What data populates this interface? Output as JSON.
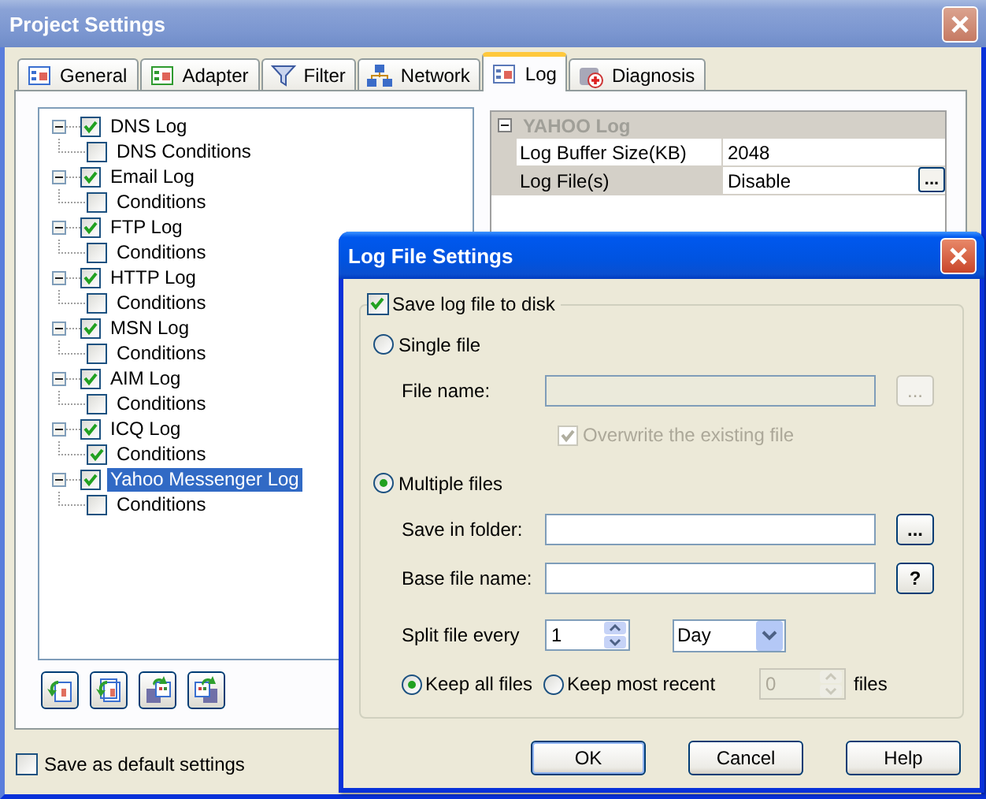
{
  "window": {
    "title": "Project Settings"
  },
  "tabs": [
    {
      "label": "General",
      "selected": false
    },
    {
      "label": "Adapter",
      "selected": false
    },
    {
      "label": "Filter",
      "selected": false
    },
    {
      "label": "Network",
      "selected": false
    },
    {
      "label": "Log",
      "selected": true
    },
    {
      "label": "Diagnosis",
      "selected": false
    }
  ],
  "tree": [
    {
      "label": "DNS Log",
      "checked": true,
      "selected": false,
      "expanded": true,
      "children": [
        {
          "label": "DNS Conditions",
          "checked": false,
          "selected": false
        }
      ]
    },
    {
      "label": "Email Log",
      "checked": true,
      "selected": false,
      "expanded": true,
      "children": [
        {
          "label": "Conditions",
          "checked": false,
          "selected": false
        }
      ]
    },
    {
      "label": "FTP Log",
      "checked": true,
      "selected": false,
      "expanded": true,
      "children": [
        {
          "label": "Conditions",
          "checked": false,
          "selected": false
        }
      ]
    },
    {
      "label": "HTTP Log",
      "checked": true,
      "selected": false,
      "expanded": true,
      "children": [
        {
          "label": "Conditions",
          "checked": false,
          "selected": false
        }
      ]
    },
    {
      "label": "MSN Log",
      "checked": true,
      "selected": false,
      "expanded": true,
      "children": [
        {
          "label": "Conditions",
          "checked": false,
          "selected": false
        }
      ]
    },
    {
      "label": "AIM Log",
      "checked": true,
      "selected": false,
      "expanded": true,
      "children": [
        {
          "label": "Conditions",
          "checked": false,
          "selected": false
        }
      ]
    },
    {
      "label": "ICQ Log",
      "checked": true,
      "selected": false,
      "expanded": true,
      "children": [
        {
          "label": "Conditions",
          "checked": true,
          "selected": false
        }
      ]
    },
    {
      "label": "Yahoo Messenger Log",
      "checked": true,
      "selected": true,
      "expanded": true,
      "children": [
        {
          "label": "Conditions",
          "checked": false,
          "selected": false
        }
      ]
    }
  ],
  "property_grid": {
    "category": "YAHOO Log",
    "expanded": true,
    "rows": [
      {
        "name": "Log Buffer Size(KB)",
        "value": "2048",
        "selected": false
      },
      {
        "name": "Log File(s)",
        "value": "Disable",
        "selected": true,
        "button": "..."
      }
    ]
  },
  "default_settings": {
    "label": "Save as default settings",
    "checked": false
  },
  "dialog": {
    "title": "Log File Settings",
    "save_to_disk": {
      "label": "Save log file to disk",
      "checked": true
    },
    "single_file": {
      "label": "Single file",
      "selected": false
    },
    "file_name": {
      "label": "File name:",
      "disabled": true,
      "button": "..."
    },
    "overwrite": {
      "label": "Overwrite the existing file",
      "checked": true,
      "disabled": true
    },
    "multiple_files": {
      "label": "Multiple files",
      "selected": true
    },
    "save_in_folder": {
      "label": "Save in folder:",
      "disabled": false,
      "button": "..."
    },
    "base_file_name": {
      "label": "Base file name:",
      "disabled": false,
      "button": "?"
    },
    "split": {
      "label": "Split file every",
      "value": "1",
      "unit": "Day"
    },
    "keep_all": {
      "label": "Keep all files",
      "selected": true
    },
    "keep_recent": {
      "label": "Keep most recent",
      "selected": false,
      "value": "0",
      "disabled": true,
      "suffix": "files"
    },
    "buttons": [
      "OK",
      "Cancel",
      "Help"
    ]
  }
}
